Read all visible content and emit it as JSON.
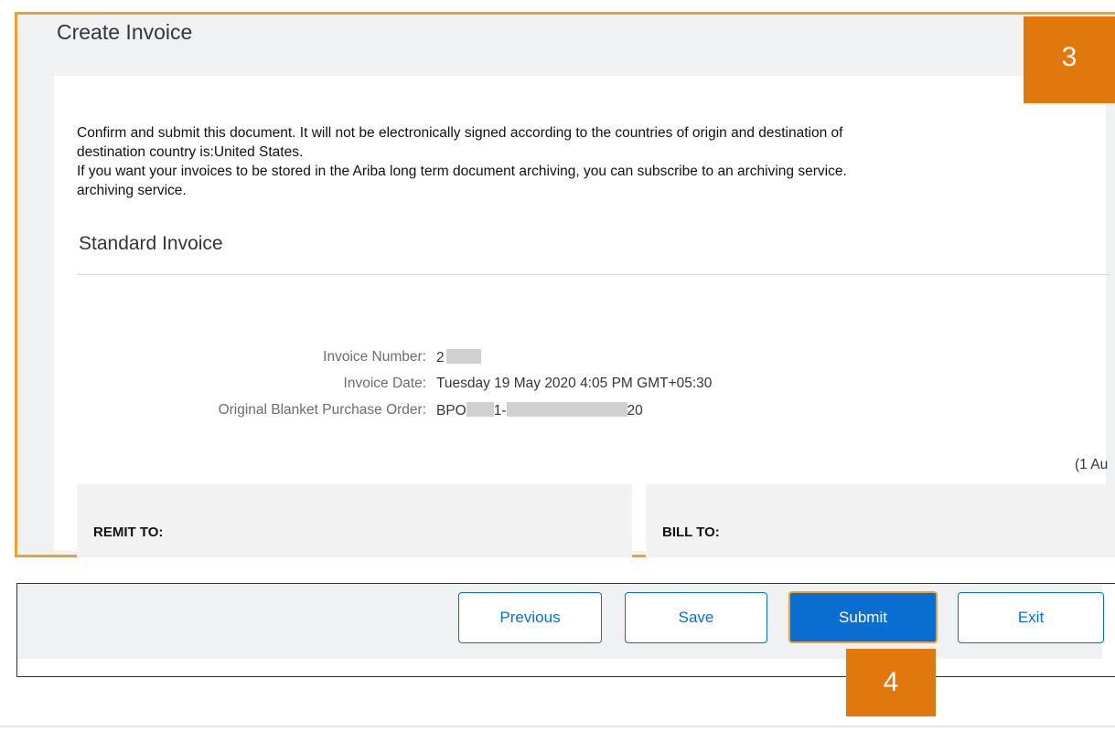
{
  "page": {
    "title": "Create Invoice",
    "callouts": {
      "step_3": "3",
      "step_4": "4"
    },
    "accent_color": "#0a6ed1",
    "highlight_color": "#f0a030",
    "callout_color": "#e0780e"
  },
  "notice": {
    "line1": "Confirm and submit this document. It will not be electronically signed according to the countries of origin and destination of",
    "line2": "destination country is:United States.",
    "line3": "If you want your invoices to be stored in the Ariba long term document archiving, you can subscribe to an archiving service.",
    "line4": "archiving service."
  },
  "invoice": {
    "section_title": "Standard Invoice",
    "number_label": "Invoice Number:",
    "number_value_prefix": "2",
    "date_label": "Invoice Date:",
    "date_value": "Tuesday 19 May 2020 4:05 PM GMT+05:30",
    "po_label": "Original Blanket Purchase Order:",
    "po_prefix": "BPO",
    "po_middle": "1-",
    "po_suffix": "20",
    "partial_text": "(1 Au"
  },
  "addresses": {
    "remit_label": "REMIT TO:",
    "bill_label": "BILL TO:"
  },
  "toolbar": {
    "previous_label": "Previous",
    "save_label": "Save",
    "submit_label": "Submit",
    "exit_label": "Exit"
  }
}
